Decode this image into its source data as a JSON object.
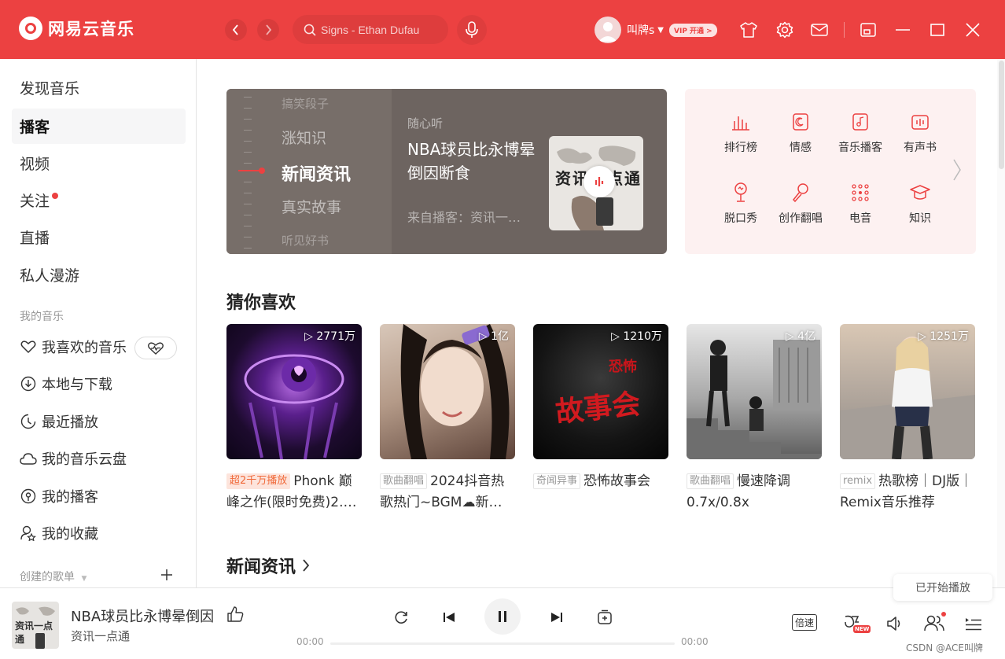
{
  "app": {
    "name": "网易云音乐"
  },
  "header": {
    "search_placeholder": "Signs - Ethan Dufau",
    "username": "叫牌s",
    "vip_label": "VIP 开通 >"
  },
  "sidebar": {
    "nav": [
      {
        "label": "发现音乐"
      },
      {
        "label": "播客",
        "active": true
      },
      {
        "label": "视频"
      },
      {
        "label": "关注",
        "badge": true
      },
      {
        "label": "直播"
      },
      {
        "label": "私人漫游"
      }
    ],
    "my_music_title": "我的音乐",
    "my_music": [
      {
        "label": "我喜欢的音乐",
        "icon": "heart-icon"
      },
      {
        "label": "本地与下载",
        "icon": "download-icon"
      },
      {
        "label": "最近播放",
        "icon": "clock-icon"
      },
      {
        "label": "我的音乐云盘",
        "icon": "cloud-icon"
      },
      {
        "label": "我的播客",
        "icon": "podcast-icon"
      },
      {
        "label": "我的收藏",
        "icon": "collection-icon"
      }
    ],
    "created_playlists_title": "创建的歌单"
  },
  "banner": {
    "categories": [
      "搞笑段子",
      "涨知识",
      "新闻资讯",
      "真实故事",
      "听见好书"
    ],
    "active_index": 2,
    "tag": "随心听",
    "title": "NBA球员比永博晕倒因断食",
    "from": "来自播客：资讯一…",
    "cover_text": "资讯一点通"
  },
  "categories_panel": {
    "items": [
      {
        "label": "排行榜",
        "icon": "chart-icon"
      },
      {
        "label": "情感",
        "icon": "emotion-icon"
      },
      {
        "label": "音乐播客",
        "icon": "music-podcast-icon"
      },
      {
        "label": "有声书",
        "icon": "audiobook-icon"
      },
      {
        "label": "脱口秀",
        "icon": "talkshow-icon"
      },
      {
        "label": "创作翻唱",
        "icon": "microphone-icon"
      },
      {
        "label": "电音",
        "icon": "electronic-icon"
      },
      {
        "label": "知识",
        "icon": "knowledge-icon"
      }
    ]
  },
  "recommend": {
    "title": "猜你喜欢",
    "cards": [
      {
        "plays": "2771万",
        "tag": "超2千万播放",
        "hot": true,
        "title": "Phonk 巅峰之作(限时免费)2.…",
        "colors": [
          "#2a0e3f",
          "#7a2ab8"
        ]
      },
      {
        "plays": "1亿",
        "tag": "歌曲翻唱",
        "hot": false,
        "title": "2024抖音热歌热门~BGM☁新…",
        "colors": [
          "#c9b6a8",
          "#6b4f44"
        ]
      },
      {
        "plays": "1210万",
        "tag": "奇闻异事",
        "hot": false,
        "title": "恐怖故事会",
        "colors": [
          "#0e0e0e",
          "#8b1a1a"
        ]
      },
      {
        "plays": "4亿",
        "tag": "歌曲翻唱",
        "hot": false,
        "title": "慢速降调0.7x/0.8x",
        "colors": [
          "#d9d9d9",
          "#4a4a4a"
        ]
      },
      {
        "plays": "1251万",
        "tag": "remix",
        "hot": false,
        "title": "热歌榜｜DJ版｜Remix音乐推荐",
        "colors": [
          "#b8aea5",
          "#3a3f55"
        ]
      }
    ],
    "horror_title_text": "恐怖",
    "horror_sub_text": "故事会"
  },
  "news": {
    "title": "新闻资讯"
  },
  "toast": "已开始播放",
  "player": {
    "title": "NBA球员比永博晕倒因",
    "artist": "资讯一点通",
    "cover_text": "资讯一点通",
    "time_current": "00:00",
    "time_total": "00:00",
    "speed_label": "倍速",
    "new_badge": "NEW",
    "watermark": "CSDN @ACE叫牌"
  },
  "colors": {
    "brand": "#ec4141"
  }
}
